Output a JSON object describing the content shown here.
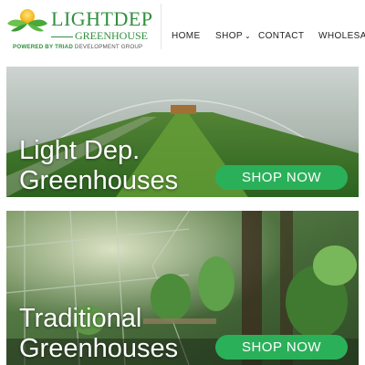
{
  "logo": {
    "title_main": "LIGHT",
    "title_accent": "DEP",
    "subtitle": "GREENHOUSE",
    "powered_by": "POWERED BY TRIAD",
    "powered_rest": "DEVELOPMENT GROUP"
  },
  "nav": {
    "items": [
      {
        "label": "HOME"
      },
      {
        "label": "SHOP",
        "has_dropdown": true
      },
      {
        "label": "CONTACT"
      },
      {
        "label": "WHOLESAL"
      }
    ],
    "dropdown_icon": "chevron-down-icon"
  },
  "banners": [
    {
      "title_line1": "Light Dep.",
      "title_line2": "Greenhouses",
      "button_label": "SHOP NOW"
    },
    {
      "title_line1": "Traditional",
      "title_line2": "Greenhouses",
      "button_label": "SHOP NOW"
    }
  ],
  "colors": {
    "brand_green": "#2f8f3c",
    "button_green": "#2bb05a",
    "nav_text": "#222222"
  }
}
